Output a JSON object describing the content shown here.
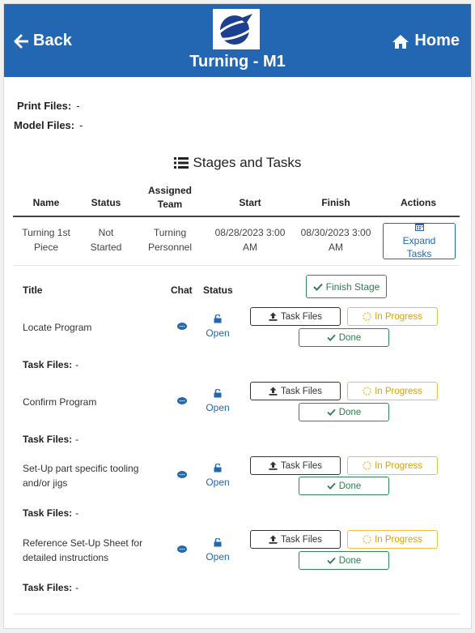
{
  "header": {
    "back_label": "Back",
    "home_label": "Home",
    "title": "Turning  - M1",
    "bg_color": "#2367b3"
  },
  "files": {
    "print_label": "Print Files:",
    "print_value": "-",
    "model_label": "Model Files:",
    "model_value": "-"
  },
  "stages": {
    "heading": "Stages and Tasks",
    "columns": [
      "Name",
      "Status",
      "Assigned\nTeam",
      "Start",
      "Finish",
      "Actions"
    ],
    "row": {
      "name": "Turning 1st Piece",
      "status": "Not Started",
      "team": "Turning Personnel",
      "start": "08/28/2023 3:00 AM",
      "finish": "08/30/2023 3:00 AM",
      "action_label": "Expand Tasks"
    }
  },
  "tasks": {
    "col_title": "Title",
    "col_chat": "Chat",
    "col_status": "Status",
    "finish_stage_label": "Finish Stage",
    "files_button_label": "Task Files",
    "progress_button_label": "In Progress",
    "done_button_label": "Done",
    "task_files_label": "Task Files:",
    "task_files_value": "-",
    "items": [
      {
        "title": "Locate Program",
        "status": "Open"
      },
      {
        "title": "Confirm Program",
        "status": "Open"
      },
      {
        "title": "Set-Up part specific tooling and/or jigs",
        "status": "Open"
      },
      {
        "title": "Reference Set-Up Sheet for detailed instructions",
        "status": "Open"
      }
    ]
  }
}
